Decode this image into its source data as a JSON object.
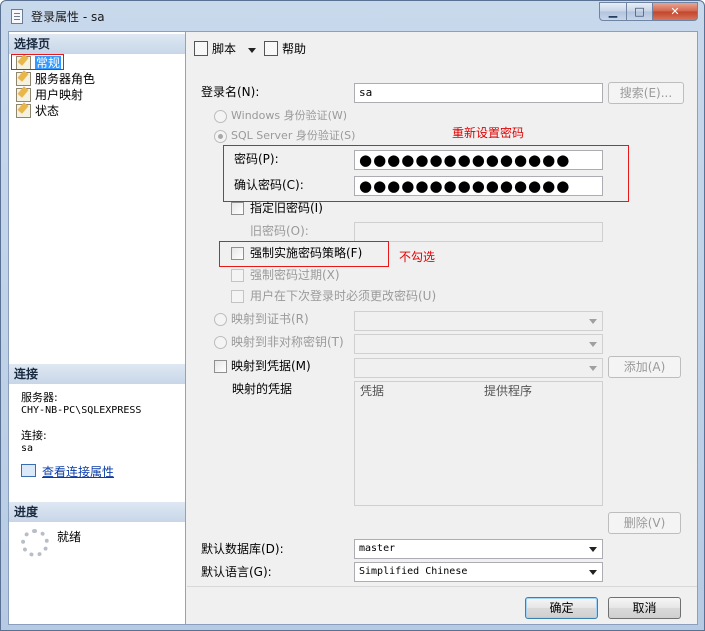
{
  "window": {
    "title": "登录属性 - sa",
    "min": "▁",
    "max": "□",
    "close": "✕"
  },
  "left": {
    "select_page_header": "选择页",
    "pages": [
      "常规",
      "服务器角色",
      "用户映射",
      "状态"
    ],
    "connection_header": "连接",
    "server_label": "服务器:",
    "server_value": "CHY-NB-PC\\SQLEXPRESS",
    "connection_label": "连接:",
    "connection_value": "sa",
    "view_link": "查看连接属性",
    "progress_header": "进度",
    "progress_status": "就绪"
  },
  "toolbar": {
    "script": "脚本",
    "help": "帮助"
  },
  "form": {
    "login_name_label": "登录名(N):",
    "login_name_value": "sa",
    "search_button": "搜索(E)...",
    "windows_auth": "Windows 身份验证(W)",
    "sql_auth": "SQL Server 身份验证(S)",
    "password_label": "密码(P):",
    "password_value": "●●●●●●●●●●●●●●●",
    "confirm_label": "确认密码(C):",
    "confirm_value": "●●●●●●●●●●●●●●●",
    "specify_old": "指定旧密码(I)",
    "old_password_label": "旧密码(O):",
    "enforce_policy": "强制实施密码策略(F)",
    "enforce_expiration": "强制密码过期(X)",
    "must_change": "用户在下次登录时必须更改密码(U)",
    "map_cert": "映射到证书(R)",
    "map_asym": "映射到非对称密钥(T)",
    "map_cred": "映射到凭据(M)",
    "add_button": "添加(A)",
    "mapped_creds_label": "映射的凭据",
    "grid_cols": [
      "凭据",
      "提供程序"
    ],
    "remove_button": "删除(V)",
    "default_db_label": "默认数据库(D):",
    "default_db_value": "master",
    "default_lang_label": "默认语言(G):",
    "default_lang_value": "Simplified Chinese"
  },
  "annotations": {
    "reset_password": "重新设置密码",
    "uncheck": "不勾选"
  },
  "buttons": {
    "ok": "确定",
    "cancel": "取消"
  }
}
